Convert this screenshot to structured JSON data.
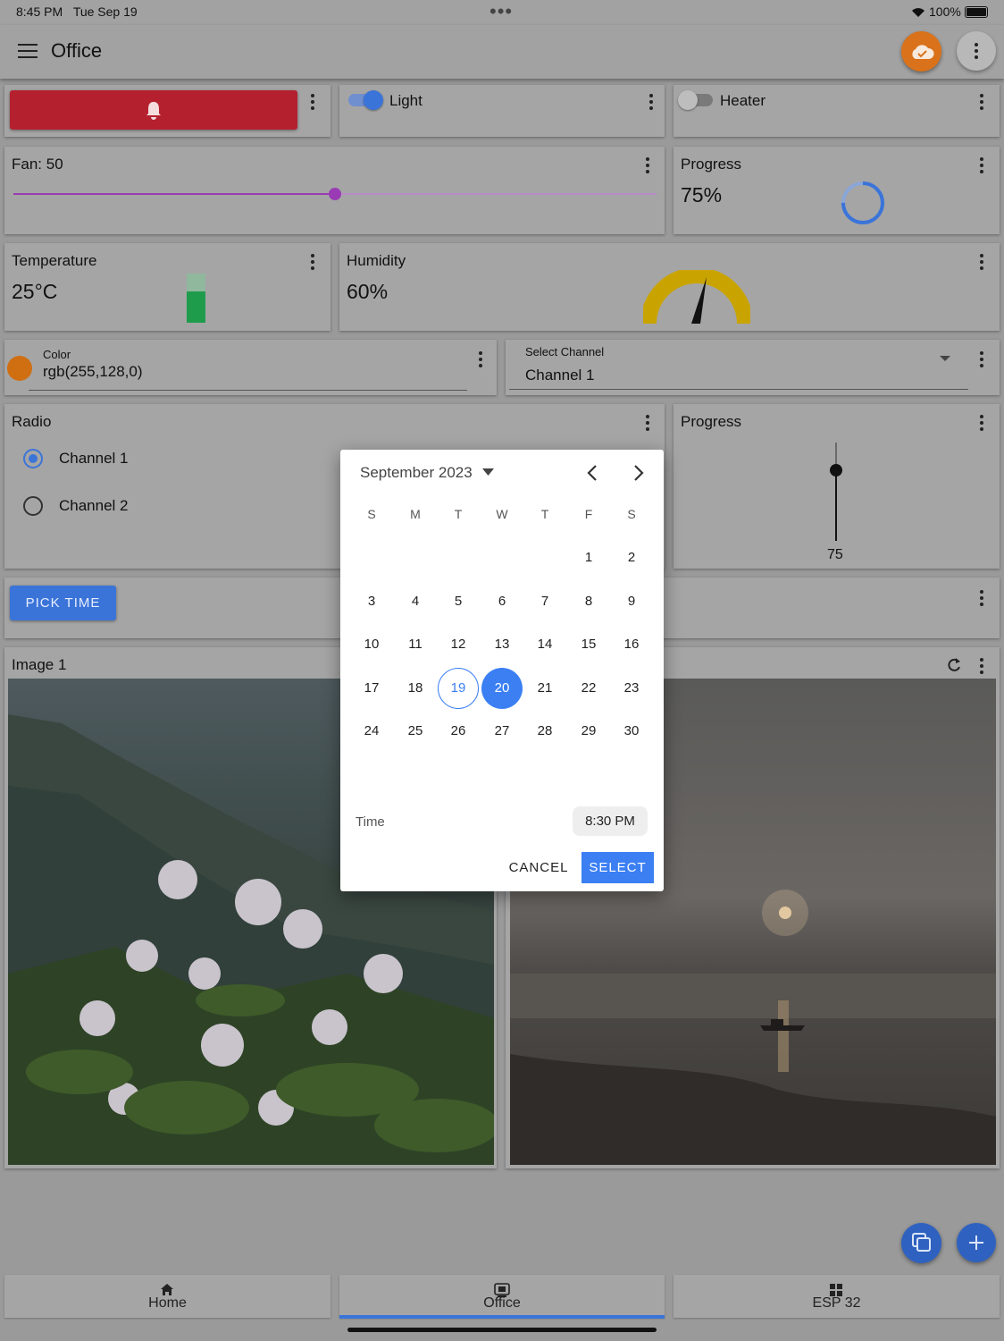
{
  "status_bar": {
    "time": "8:45 PM",
    "date": "Tue Sep 19",
    "battery": "100%"
  },
  "app_bar": {
    "title": "Office"
  },
  "widgets": {
    "light_label": "Light",
    "heater_label": "Heater",
    "fan_label": "Fan: 50",
    "fan_value": 50,
    "progress_title": "Progress",
    "progress_value": "75%",
    "progress_fraction": 0.75,
    "temperature_title": "Temperature",
    "temperature_value": "25°C",
    "humidity_title": "Humidity",
    "humidity_value": "60%",
    "color_label": "Color",
    "color_value": "rgb(255,128,0)",
    "select_label": "Select Channel",
    "select_value": "Channel 1",
    "radio_title": "Radio",
    "radio_options": [
      "Channel 1",
      "Channel 2"
    ],
    "progress2_title": "Progress",
    "progress2_value": "75",
    "pick_time_label": "PICK TIME",
    "image1_title": "Image 1"
  },
  "date_picker": {
    "month_label": "September 2023",
    "weekdays": [
      "S",
      "M",
      "T",
      "W",
      "T",
      "F",
      "S"
    ],
    "weeks": [
      [
        "",
        "",
        "",
        "",
        "",
        "1",
        "2"
      ],
      [
        "3",
        "4",
        "5",
        "6",
        "7",
        "8",
        "9"
      ],
      [
        "10",
        "11",
        "12",
        "13",
        "14",
        "15",
        "16"
      ],
      [
        "17",
        "18",
        "19",
        "20",
        "21",
        "22",
        "23"
      ],
      [
        "24",
        "25",
        "26",
        "27",
        "28",
        "29",
        "30"
      ]
    ],
    "today": "19",
    "selected": "20",
    "time_label": "Time",
    "time_value": "8:30 PM",
    "cancel_label": "CANCEL",
    "select_label": "SELECT"
  },
  "bottom_nav": {
    "tabs": [
      {
        "label": "Home",
        "icon": "home-icon"
      },
      {
        "label": "Office",
        "icon": "office-icon"
      },
      {
        "label": "ESP 32",
        "icon": "grid-icon"
      }
    ],
    "active": "Office"
  },
  "colors": {
    "accent": "#3b74d9",
    "alarm": "#b5202f",
    "cloud": "#d9721a",
    "slider": "#9a3bb5",
    "gauge": "#c9a400",
    "bar_green": "#1e9c4c"
  }
}
